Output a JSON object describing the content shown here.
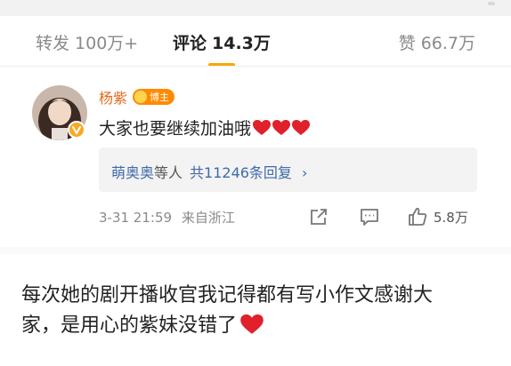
{
  "tabs": {
    "reposts_label": "转发",
    "reposts_count": "100万+",
    "comments_label": "评论",
    "comments_count": "14.3万",
    "likes_label": "赞",
    "likes_count": "66.7万",
    "active_tab": "comments",
    "accent_color": "#f7a800"
  },
  "comment": {
    "username": "杨紫",
    "badge_label": "博主",
    "verified_icon": "verified-v-icon",
    "text": "大家也要继续加油哦",
    "emoji": [
      "red-heart",
      "red-heart",
      "red-heart"
    ],
    "reply_summary": {
      "user": "萌奥奥",
      "etc": "等人",
      "link_text": "共11246条回复",
      "chevron": "›"
    },
    "timestamp": "3-31 21:59",
    "location": "来自浙江",
    "like_count": "5.8万",
    "action_icons": [
      "share-icon",
      "comment-icon",
      "like-icon"
    ]
  },
  "caption": {
    "line1": "每次她的剧开播收官我记得都有写小作文感谢大",
    "line2": "家，是用心的紫妹没错了",
    "emoji": "red-heart"
  }
}
